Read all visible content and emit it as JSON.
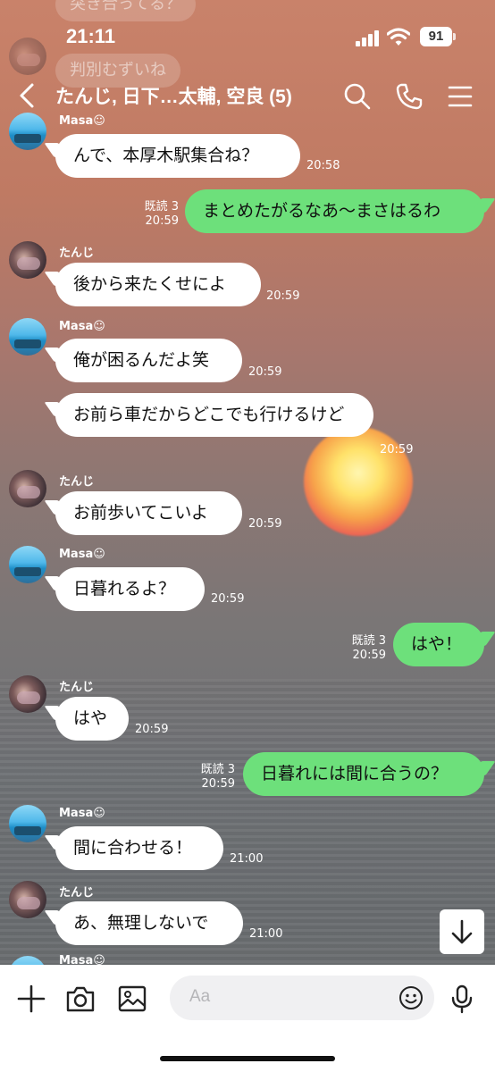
{
  "status": {
    "time": "21:11",
    "battery": "91"
  },
  "header": {
    "title": "たんじ, 日下…太輔, 空良 (5)"
  },
  "ghosts": [
    "突き合ってる？",
    "判別むずいね"
  ],
  "messages": [
    {
      "sender": "Masa☺",
      "text": "んで、本厚木駅集合ね？",
      "time": "20:58"
    },
    {
      "read": "既読 3",
      "time": "20:59",
      "text": "まとめたがるなあ〜まさはるわ"
    },
    {
      "sender": "たんじ",
      "text": "後から来たくせによ",
      "time": "20:59"
    },
    {
      "sender": "Masa☺",
      "text": "俺が困るんだよ笑",
      "time": "20:59"
    },
    {
      "text": "お前ら車だからどこでも行けるけど",
      "time": "20:59"
    },
    {
      "sender": "たんじ",
      "text": "お前歩いてこいよ",
      "time": "20:59"
    },
    {
      "sender": "Masa☺",
      "text": "日暮れるよ？",
      "time": "20:59"
    },
    {
      "read": "既読 3",
      "time": "20:59",
      "text": "はや！"
    },
    {
      "sender": "たんじ",
      "text": "はや",
      "time": "20:59"
    },
    {
      "read": "既読 3",
      "time": "20:59",
      "text": "日暮れには間に合うの？"
    },
    {
      "sender": "Masa☺",
      "text": "間に合わせる！",
      "time": "21:00"
    },
    {
      "sender": "たんじ",
      "text": "あ、無理しないで",
      "time": "21:00"
    },
    {
      "sender": "Masa☺"
    }
  ],
  "input": {
    "placeholder": "Aa"
  },
  "colors": {
    "outgoing": "#6de07b",
    "incoming": "#ffffff"
  },
  "icons": [
    "back-chevron-icon",
    "search-icon",
    "phone-icon",
    "menu-icon",
    "scroll-down-icon",
    "plus-icon",
    "camera-icon",
    "image-icon",
    "emoji-icon",
    "microphone-icon"
  ]
}
